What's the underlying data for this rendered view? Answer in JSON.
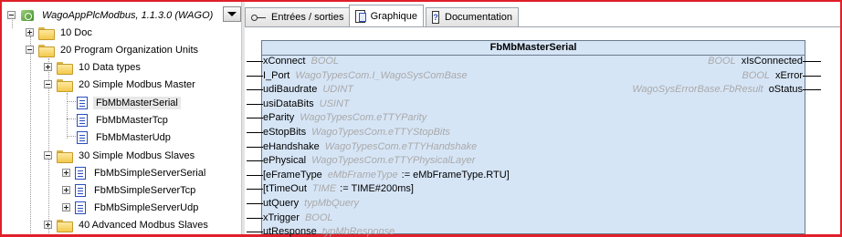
{
  "tree": {
    "root": {
      "label": "WagoAppPlcModbus, 1.1.3.0 (WAGO)"
    },
    "items": [
      {
        "label": "10 Doc"
      },
      {
        "label": "20 Program Organization Units"
      },
      {
        "label": "10 Data types"
      },
      {
        "label": "20 Simple Modbus Master"
      },
      {
        "label": "FbMbMasterSerial"
      },
      {
        "label": "FbMbMasterTcp"
      },
      {
        "label": "FbMbMasterUdp"
      },
      {
        "label": "30 Simple Modbus Slaves"
      },
      {
        "label": "FbMbSimpleServerSerial"
      },
      {
        "label": "FbMbSimpleServerTcp"
      },
      {
        "label": "FbMbSimpleServerUdp"
      },
      {
        "label": "40 Advanced Modbus Slaves"
      }
    ]
  },
  "tabs": [
    {
      "label": "Entrées / sorties",
      "icon": "io-icon"
    },
    {
      "label": "Graphique",
      "icon": "graphic-icon"
    },
    {
      "label": "Documentation",
      "icon": "documentation-icon"
    }
  ],
  "block": {
    "name": "FbMbMasterSerial",
    "inputs": [
      {
        "name": "xConnect",
        "type": "BOOL",
        "init": ""
      },
      {
        "name": "I_Port",
        "type": "WagoTypesCom.I_WagoSysComBase",
        "init": ""
      },
      {
        "name": "udiBaudrate",
        "type": "UDINT",
        "init": ""
      },
      {
        "name": "usiDataBits",
        "type": "USINT",
        "init": ""
      },
      {
        "name": "eParity",
        "type": "WagoTypesCom.eTTYParity",
        "init": ""
      },
      {
        "name": "eStopBits",
        "type": "WagoTypesCom.eTTYStopBits",
        "init": ""
      },
      {
        "name": "eHandshake",
        "type": "WagoTypesCom.eTTYHandshake",
        "init": ""
      },
      {
        "name": "ePhysical",
        "type": "WagoTypesCom.eTTYPhysicalLayer",
        "init": ""
      },
      {
        "name": "[eFrameType",
        "type": "eMbFrameType",
        "init": ":= eMbFrameType.RTU]"
      },
      {
        "name": "[tTimeOut",
        "type": "TIME",
        "init": ":= TIME#200ms]"
      },
      {
        "name": "utQuery",
        "type": "typMbQuery",
        "init": ""
      },
      {
        "name": "xTrigger",
        "type": "BOOL",
        "init": ""
      },
      {
        "name": "utResponse",
        "type": "typMbResponse",
        "init": ""
      }
    ],
    "outputs": [
      {
        "name": "xIsConnected",
        "type": "BOOL"
      },
      {
        "name": "xError",
        "type": "BOOL"
      },
      {
        "name": "oStatus",
        "type": "WagoSysErrorBase.FbResult"
      }
    ]
  }
}
